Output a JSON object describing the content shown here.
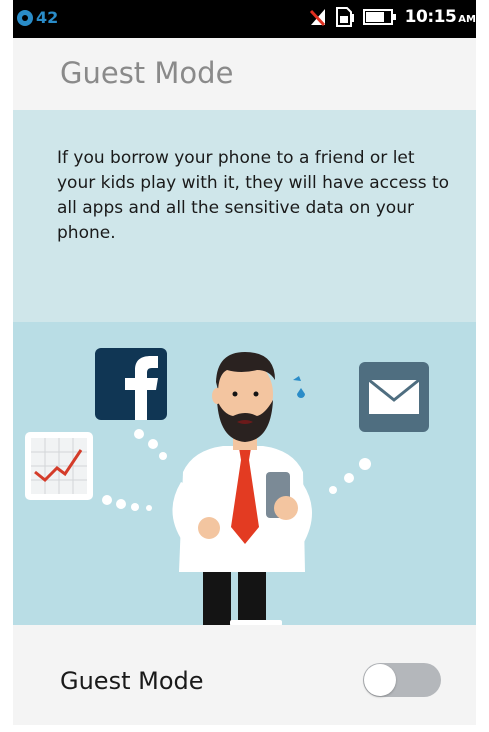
{
  "status_bar": {
    "notification_count": "42",
    "time": "10:15",
    "ampm": "AM",
    "icons": [
      "notification-dot-icon",
      "muted-signal-icon",
      "sim-icon",
      "battery-icon"
    ]
  },
  "header": {
    "title": "Guest Mode"
  },
  "intro": {
    "text": "If you borrow your phone to a friend or let your kids play with it, they will have access to all apps and all the sensitive data on your phone."
  },
  "illustration": {
    "icons": [
      "facebook-icon",
      "chart-icon",
      "mail-icon",
      "person-with-phone-illustration"
    ]
  },
  "setting": {
    "label": "Guest Mode",
    "enabled": false
  },
  "colors": {
    "panel_bg": "#cfe6ea",
    "illustration_bg": "#b9dde5",
    "accent_blue": "#2a8cc8",
    "toggle_off": "#b4b7bb"
  }
}
